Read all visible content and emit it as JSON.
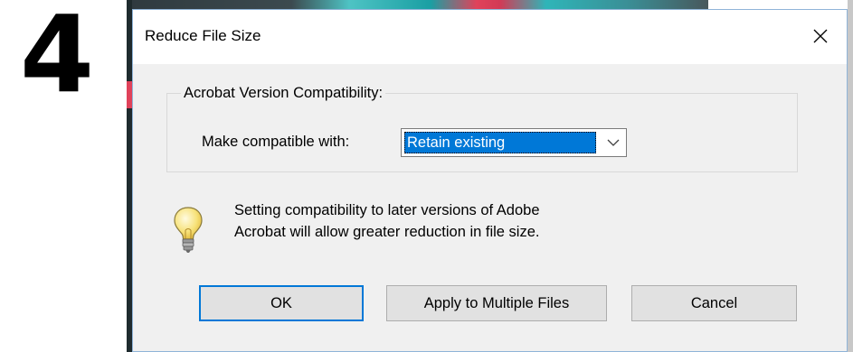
{
  "step": {
    "number": "4"
  },
  "dialog": {
    "title": "Reduce File Size",
    "close_icon": "close-icon",
    "group": {
      "legend": "Acrobat Version Compatibility:",
      "compat_label": "Make compatible with:",
      "compat_selected": "Retain existing"
    },
    "info": {
      "icon": "lightbulb-icon",
      "line1": "Setting compatibility to later versions of Adobe",
      "line2": "Acrobat will allow greater reduction in file size."
    },
    "buttons": {
      "ok": "OK",
      "apply_multiple": "Apply to Multiple Files",
      "cancel": "Cancel"
    }
  },
  "colors": {
    "accent": "#0078d7",
    "dialog_bg": "#f0f0f0",
    "titlebar_bg": "#ffffff",
    "button_bg": "#e1e1e1"
  }
}
